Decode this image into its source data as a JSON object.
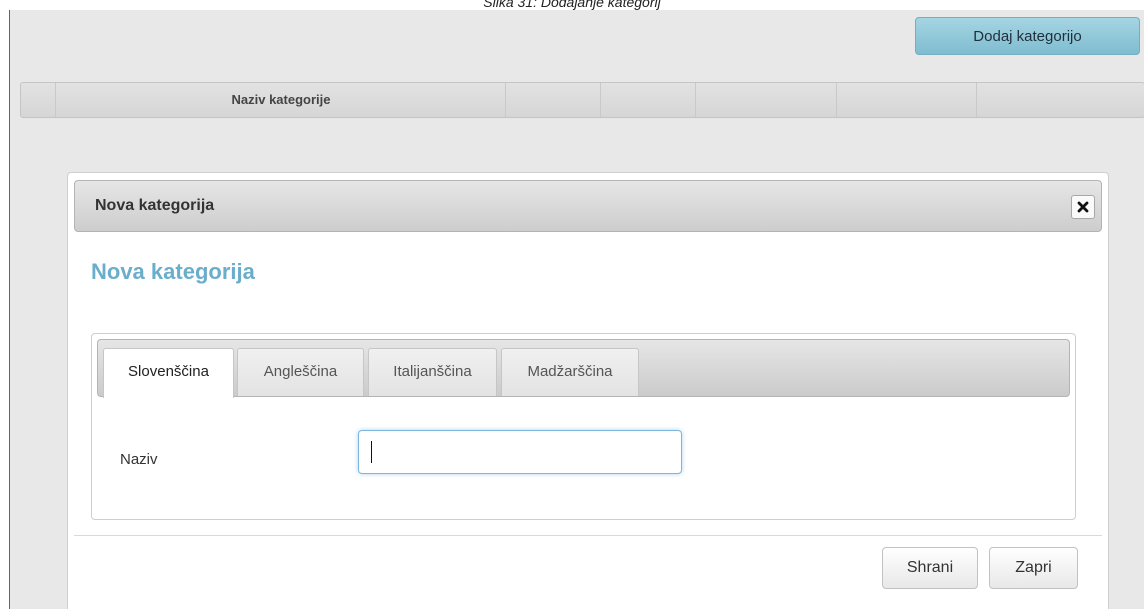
{
  "caption": "Slika 31: Dodajanje kategorij",
  "toolbar": {
    "add_category_label": "Dodaj kategorijo"
  },
  "grid": {
    "column_header": "Naziv kategorije"
  },
  "modal": {
    "header_title": "Nova kategorija",
    "heading": "Nova kategorija",
    "close_icon": "close-icon",
    "tabs": [
      {
        "label": "Slovenščina",
        "active": true
      },
      {
        "label": "Angleščina",
        "active": false
      },
      {
        "label": "Italijanščina",
        "active": false
      },
      {
        "label": "Madžarščina",
        "active": false
      }
    ],
    "field": {
      "label": "Naziv",
      "value": "",
      "placeholder": ""
    },
    "buttons": {
      "save": "Shrani",
      "close": "Zapri"
    }
  },
  "colors": {
    "accent_heading": "#6aaecb",
    "add_button": "#8cc8db",
    "input_focus": "#7db8df"
  }
}
